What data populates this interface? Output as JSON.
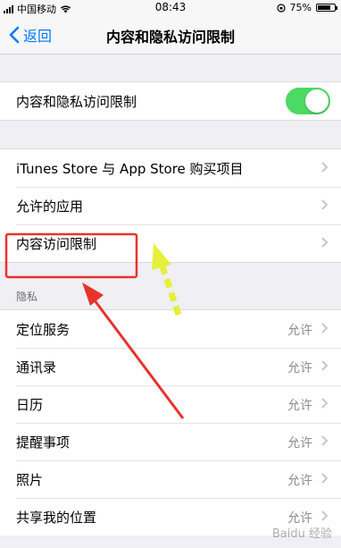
{
  "status_bar": {
    "carrier": "中国移动",
    "time": "08:43",
    "battery": "75%",
    "battery_level": 0.75
  },
  "nav": {
    "back_label": "返回",
    "title": "内容和隐私访问限制"
  },
  "toggle_row": {
    "label": "内容和隐私访问限制",
    "enabled": true
  },
  "menu": [
    {
      "label": "iTunes Store 与 App Store 购买项目"
    },
    {
      "label": "允许的应用"
    },
    {
      "label": "内容访问限制"
    }
  ],
  "privacy": {
    "header": "隐私",
    "items": [
      {
        "label": "定位服务",
        "value": "允许"
      },
      {
        "label": "通讯录",
        "value": "允许"
      },
      {
        "label": "日历",
        "value": "允许"
      },
      {
        "label": "提醒事项",
        "value": "允许"
      },
      {
        "label": "照片",
        "value": "允许"
      },
      {
        "label": "共享我的位置",
        "value": "允许"
      }
    ]
  },
  "colors": {
    "accent": "#007aff",
    "toggle_on": "#4cd964",
    "highlight_box": "#e8332b",
    "arrow_red": "#e8332b",
    "arrow_yellow": "#e6ef3a"
  },
  "watermark": "Baidu 经验"
}
